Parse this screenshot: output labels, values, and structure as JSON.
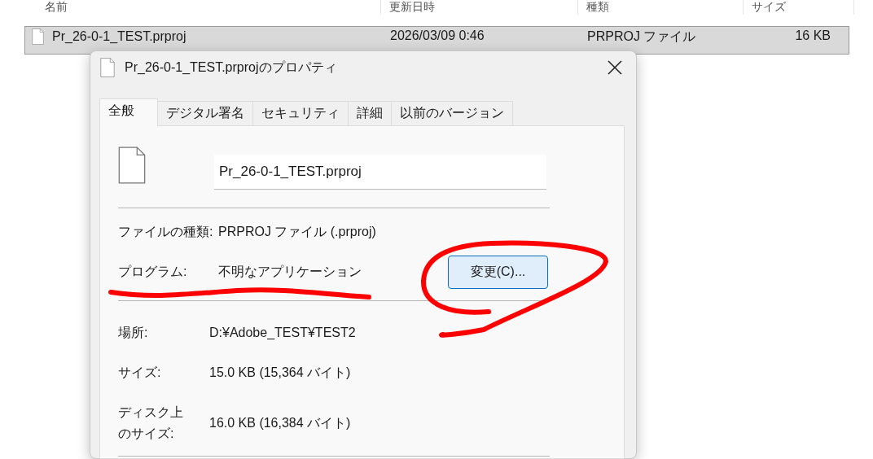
{
  "explorer": {
    "columns": [
      "名前",
      "更新日時",
      "種類",
      "サイズ"
    ],
    "rows": [
      {
        "name": "Pr_26-0-1_TEST.prproj",
        "modified": "2026/03/09 0:46",
        "type": "PRPROJ ファイル",
        "size": "16 KB",
        "selected": true
      }
    ]
  },
  "dialog": {
    "title": "Pr_26-0-1_TEST.prprojのプロパティ",
    "tabs": [
      {
        "label": "全般",
        "selected": true
      },
      {
        "label": "デジタル署名",
        "selected": false
      },
      {
        "label": "セキュリティ",
        "selected": false
      },
      {
        "label": "詳細",
        "selected": false
      },
      {
        "label": "以前のバージョン",
        "selected": false
      }
    ],
    "filename": "Pr_26-0-1_TEST.prproj",
    "sections": [
      [
        {
          "label": "ファイルの種類:",
          "value": "PRPROJ ファイル (.prproj)"
        },
        {
          "label": "プログラム:",
          "value": "不明なアプリケーション",
          "button": "変更(C)..."
        }
      ],
      [
        {
          "label": "場所:",
          "value": "D:¥Adobe_TEST¥TEST2"
        },
        {
          "label": "サイズ:",
          "value": "15.0 KB (15,364 バイト)"
        },
        {
          "label": "ディスク上のサイズ:",
          "value": "16.0 KB (16,384 バイト)"
        }
      ]
    ]
  }
}
